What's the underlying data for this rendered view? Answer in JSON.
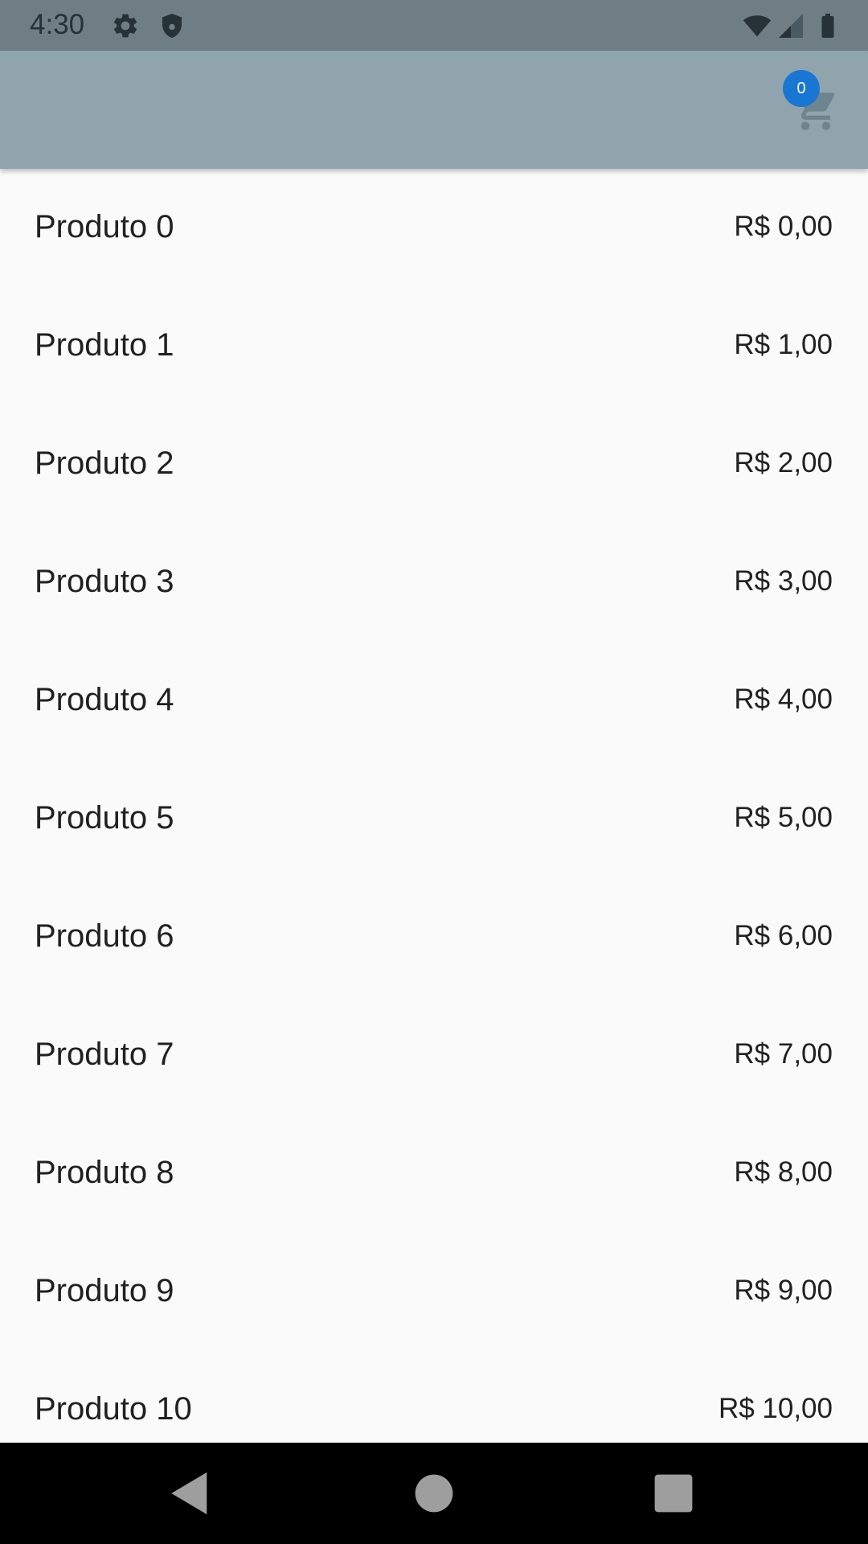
{
  "status_bar": {
    "time": "4:30",
    "icons": [
      "gear-icon",
      "shield-icon",
      "wifi-icon",
      "signal-icon",
      "battery-icon"
    ]
  },
  "app_bar": {
    "cart": {
      "icon": "shopping-cart-icon",
      "badge_count": "0"
    }
  },
  "colors": {
    "status_bar": "#6f7d85",
    "app_bar": "#90a4ae",
    "badge": "#1976d2",
    "background": "#fafafa"
  },
  "products": [
    {
      "name": "Produto 0",
      "price": "R$ 0,00"
    },
    {
      "name": "Produto 1",
      "price": "R$ 1,00"
    },
    {
      "name": "Produto 2",
      "price": "R$ 2,00"
    },
    {
      "name": "Produto 3",
      "price": "R$ 3,00"
    },
    {
      "name": "Produto 4",
      "price": "R$ 4,00"
    },
    {
      "name": "Produto 5",
      "price": "R$ 5,00"
    },
    {
      "name": "Produto 6",
      "price": "R$ 6,00"
    },
    {
      "name": "Produto 7",
      "price": "R$ 7,00"
    },
    {
      "name": "Produto 8",
      "price": "R$ 8,00"
    },
    {
      "name": "Produto 9",
      "price": "R$ 9,00"
    },
    {
      "name": "Produto 10",
      "price": "R$ 10,00"
    }
  ],
  "nav_bar": {
    "buttons": [
      "back-icon",
      "home-icon",
      "recents-icon"
    ]
  }
}
